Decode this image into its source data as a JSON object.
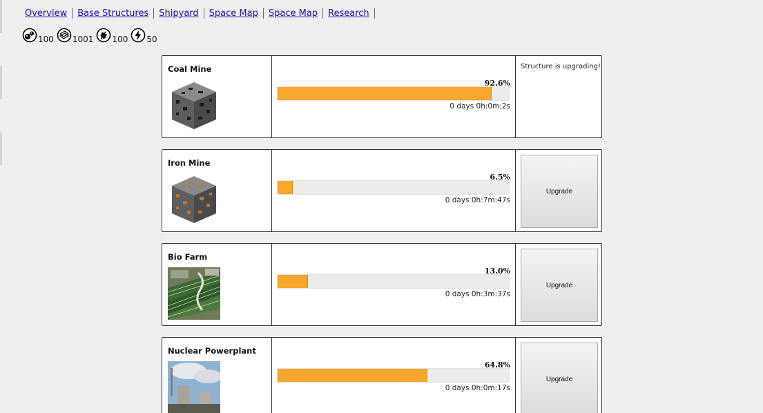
{
  "nav": {
    "items": [
      "Overview",
      "Base Structures",
      "Shipyard",
      "Space Map",
      "Space Map",
      "Research"
    ]
  },
  "resources": [
    {
      "icon": "coal-resource-icon",
      "value": "100"
    },
    {
      "icon": "iron-resource-icon",
      "value": "1001"
    },
    {
      "icon": "food-resource-icon",
      "value": "100"
    },
    {
      "icon": "energy-resource-icon",
      "value": "50"
    }
  ],
  "structures": [
    {
      "name": "Coal Mine",
      "percent_label": "92.6%",
      "progress": 92.6,
      "time": "0 days 0h:0m:2s",
      "status": "Structure is upgrading!",
      "button": ""
    },
    {
      "name": "Iron Mine",
      "percent_label": "6.5%",
      "progress": 6.5,
      "time": "0 days 0h:7m:47s",
      "status": "",
      "button": "Upgrade"
    },
    {
      "name": "Bio Farm",
      "percent_label": "13.0%",
      "progress": 13.0,
      "time": "0 days 0h:3m:37s",
      "status": "",
      "button": "Upgrade"
    },
    {
      "name": "Nuclear Powerplant",
      "percent_label": "64.8%",
      "progress": 64.8,
      "time": "0 days 0h:0m:17s",
      "status": "",
      "button": "Upgrade"
    }
  ],
  "colors": {
    "bar_fill": "#f6a72c",
    "bar_track": "#ececec",
    "link": "#1a0dab"
  }
}
